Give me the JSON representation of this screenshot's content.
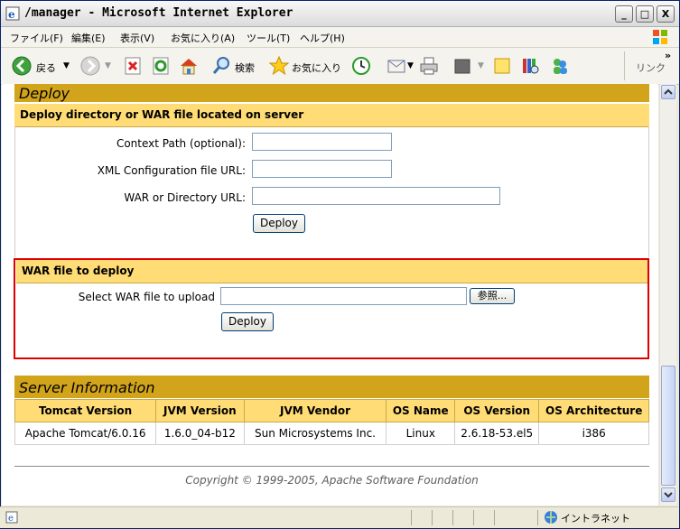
{
  "window": {
    "title": "/manager - Microsoft Internet Explorer",
    "min": "_",
    "max": "□",
    "close": "X"
  },
  "menu": [
    "ファイル(F)",
    "編集(E)",
    "表示(V)",
    "お気に入り(A)",
    "ツール(T)",
    "ヘルプ(H)"
  ],
  "toolbar": {
    "back": "戻る",
    "search": "検索",
    "favorites": "お気に入り",
    "links": "リンク",
    "more": "»"
  },
  "deploy": {
    "title": "Deploy",
    "server_section": "Deploy directory or WAR file located on server",
    "context_label": "Context Path (optional):",
    "xml_label": "XML Configuration file URL:",
    "war_dir_label": "WAR or Directory URL:",
    "deploy_button": "Deploy",
    "upload_section": "WAR file to deploy",
    "select_label": "Select WAR file to upload",
    "browse_button": "参照...",
    "upload_button": "Deploy"
  },
  "server_info": {
    "title": "Server Information",
    "headers": [
      "Tomcat Version",
      "JVM Version",
      "JVM Vendor",
      "OS Name",
      "OS Version",
      "OS Architecture"
    ],
    "row": [
      "Apache Tomcat/6.0.16",
      "1.6.0_04-b12",
      "Sun Microsystems Inc.",
      "Linux",
      "2.6.18-53.el5",
      "i386"
    ]
  },
  "footer": {
    "copyright": "Copyright © 1999-2005, Apache Software Foundation"
  },
  "status": {
    "zone": "イントラネット"
  },
  "colors": {
    "heading": "#d2a41c",
    "subheading": "#ffdc75",
    "highlight": "#e00000"
  }
}
